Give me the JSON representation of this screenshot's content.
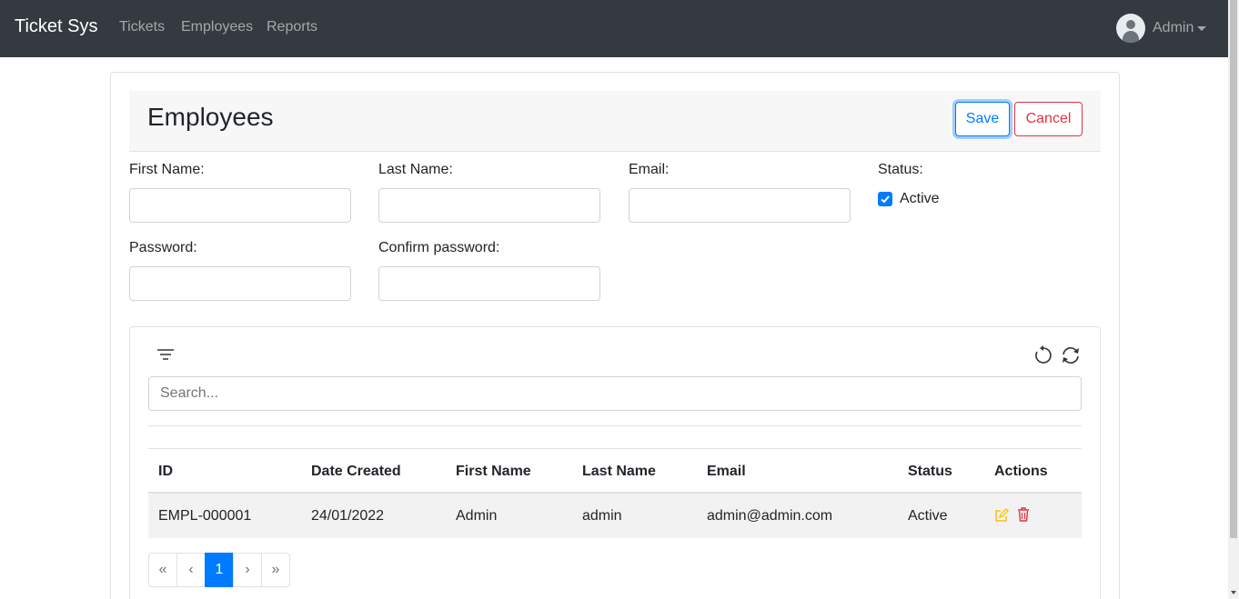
{
  "navbar": {
    "brand": "Ticket Sys",
    "links": [
      "Tickets",
      "Employees",
      "Reports"
    ],
    "user": "Admin"
  },
  "header": {
    "title": "Employees",
    "save_label": "Save",
    "cancel_label": "Cancel"
  },
  "form": {
    "first_name_label": "First Name:",
    "last_name_label": "Last Name:",
    "email_label": "Email:",
    "status_label": "Status:",
    "active_label": "Active",
    "active_checked": true,
    "password_label": "Password:",
    "confirm_password_label": "Confirm password:",
    "first_name": "",
    "last_name": "",
    "email": "",
    "password": "",
    "confirm_password": ""
  },
  "table": {
    "search_placeholder": "Search...",
    "columns": [
      "ID",
      "Date Created",
      "First Name",
      "Last Name",
      "Email",
      "Status",
      "Actions"
    ],
    "rows": [
      [
        "EMPL-000001",
        "24/01/2022",
        "Admin",
        "admin",
        "admin@admin.com",
        "Active"
      ]
    ]
  },
  "pagination": {
    "first": "«",
    "prev": "‹",
    "current": "1",
    "next": "›",
    "last": "»"
  },
  "colors": {
    "navbar": "#343a40",
    "primary": "#007bff",
    "danger": "#dc3545",
    "edit_icon": "#ffc107"
  }
}
